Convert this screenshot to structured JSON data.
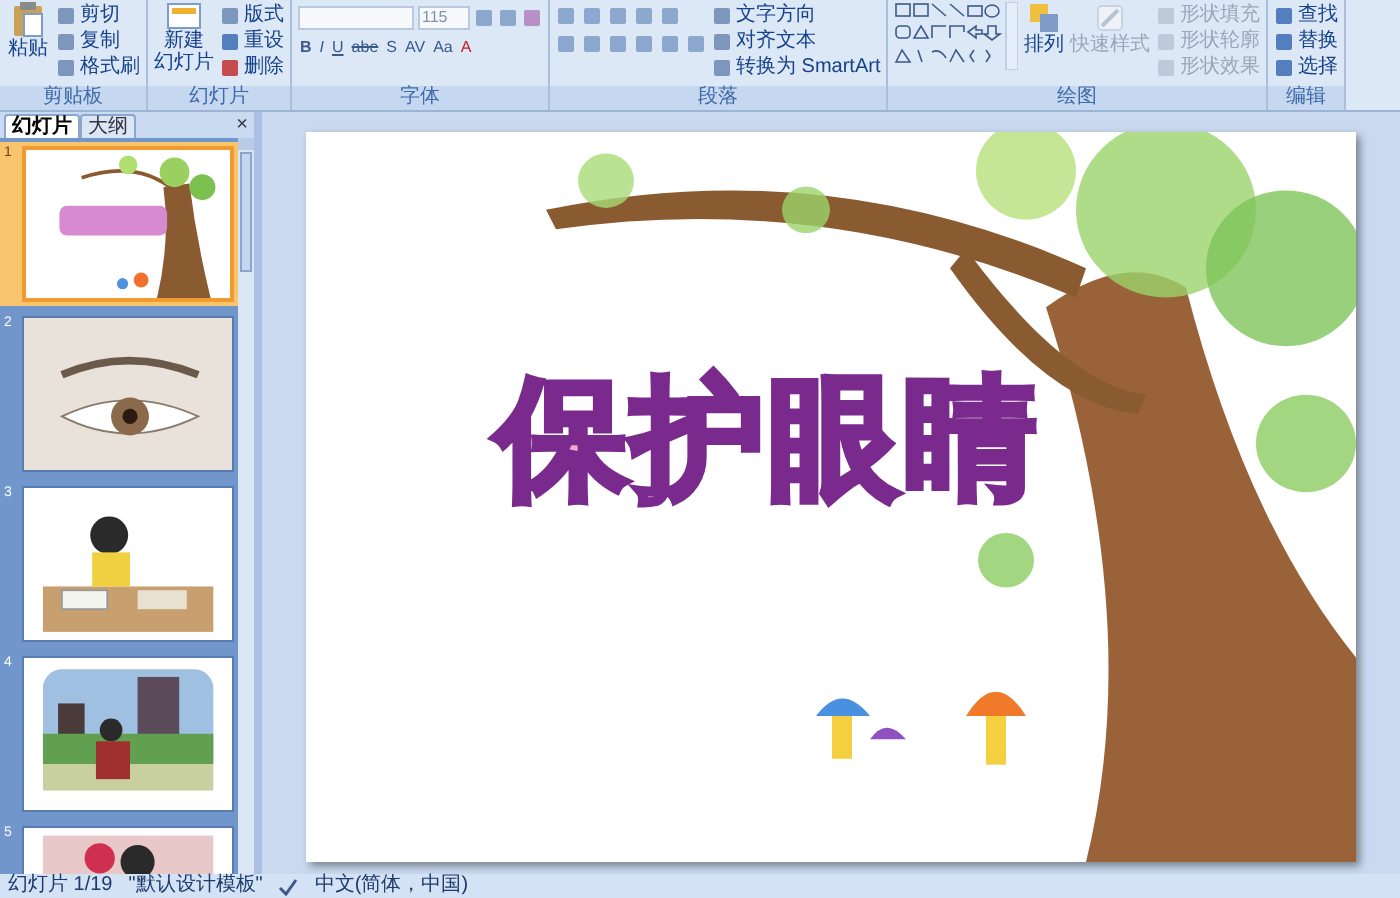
{
  "ribbon": {
    "groups": [
      {
        "kind": "clipboard",
        "label": "剪贴板",
        "items": [
          {
            "label": "粘贴"
          },
          {
            "label": "剪切"
          },
          {
            "label": "复制"
          },
          {
            "label": "格式刷"
          }
        ]
      },
      {
        "kind": "slides",
        "label": "幻灯片",
        "items": [
          {
            "label_lines": [
              "新建",
              "幻灯片"
            ]
          },
          {
            "label": "版式"
          },
          {
            "label": "重设"
          },
          {
            "label": "删除"
          }
        ]
      },
      {
        "kind": "font",
        "label": "字体",
        "font_size": "115",
        "format_buttons": [
          "B",
          "I",
          "U",
          "abe",
          "S",
          "AV",
          "Aa",
          "A"
        ]
      },
      {
        "kind": "paragraph",
        "label": "段落",
        "items": [
          {
            "label": "文字方向"
          },
          {
            "label": "对齐文本"
          },
          {
            "label": "转换为 SmartArt"
          }
        ]
      },
      {
        "kind": "drawing",
        "label": "绘图",
        "items": [
          {
            "label": "排列",
            "disabled": false
          },
          {
            "label": "快速样式",
            "disabled": true
          },
          {
            "label": "形状填充",
            "disabled": true
          },
          {
            "label": "形状轮廓",
            "disabled": true
          },
          {
            "label": "形状效果",
            "disabled": true
          }
        ]
      },
      {
        "kind": "editing",
        "label": "编辑",
        "items": [
          {
            "label": "查找"
          },
          {
            "label": "替换"
          },
          {
            "label": "选择"
          }
        ]
      }
    ]
  },
  "panel": {
    "tabs": [
      {
        "label": "幻灯片",
        "selected": true
      },
      {
        "label": "大纲",
        "selected": false
      }
    ],
    "close": "×",
    "slides": [
      {
        "number": "1",
        "selected": true
      },
      {
        "number": "2",
        "selected": false
      },
      {
        "number": "3",
        "selected": false
      },
      {
        "number": "4",
        "selected": false
      },
      {
        "number": "5",
        "selected": false
      }
    ]
  },
  "slide": {
    "title": "保护眼睛"
  },
  "status_bar": {
    "slide": "幻灯片 1/19",
    "theme": "\"默认设计模板\"",
    "language": "中文(简体，中国)"
  }
}
